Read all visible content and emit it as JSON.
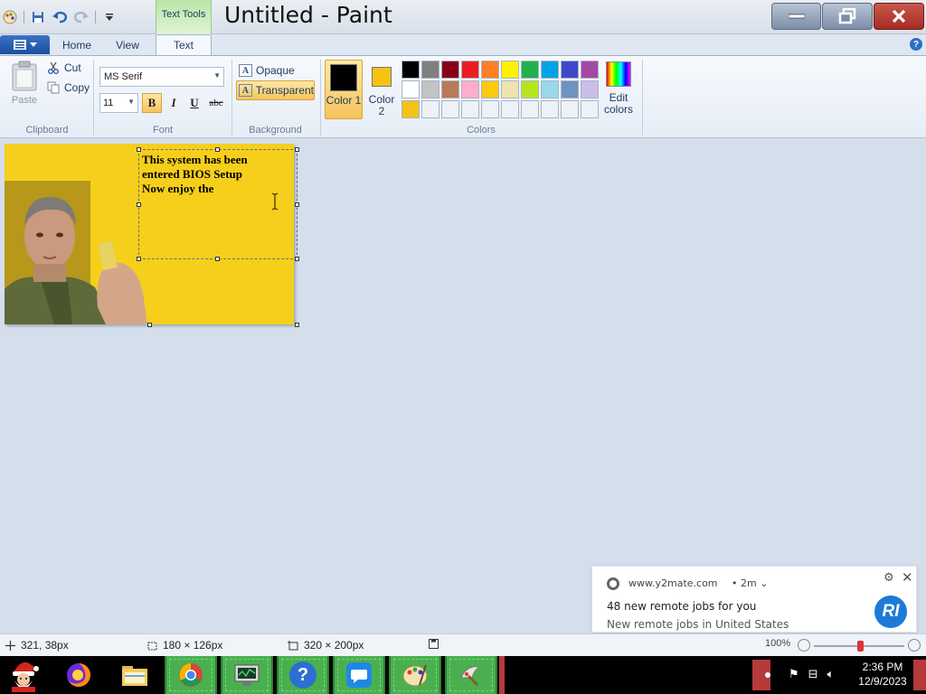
{
  "window": {
    "title": "Untitled - Paint",
    "contextual_tab_label": "Text Tools"
  },
  "tabs": [
    {
      "label": "Home"
    },
    {
      "label": "View"
    },
    {
      "label": "Text"
    }
  ],
  "ribbon": {
    "clipboard": {
      "paste_label": "Paste",
      "cut_label": "Cut",
      "copy_label": "Copy",
      "group_label": "Clipboard"
    },
    "font": {
      "family": "MS Serif",
      "size": "11",
      "bold_label": "B",
      "italic_label": "I",
      "underline_label": "U",
      "strike_label": "abc",
      "group_label": "Font",
      "bold_active": true
    },
    "background": {
      "opaque_label": "Opaque",
      "transparent_label": "Transparent",
      "group_label": "Background",
      "selected": "Transparent"
    },
    "colors": {
      "color1_label": "Color 1",
      "color2_label": "Color 2",
      "edit_label": "Edit colors",
      "group_label": "Colors",
      "color1": "#000000",
      "color2": "#f4c314",
      "palette": [
        "#000000",
        "#7f7f7f",
        "#880015",
        "#ed1c24",
        "#ff7f27",
        "#fff200",
        "#22b14c",
        "#00a2e8",
        "#3f48cc",
        "#a349a4",
        "#ffffff",
        "#c3c3c3",
        "#b97a57",
        "#ffaec9",
        "#ffc90e",
        "#efe4b0",
        "#b5e61d",
        "#99d9ea",
        "#7092be",
        "#c8bfe7",
        "#f4c314",
        "",
        "",
        "",
        "",
        "",
        "",
        "",
        "",
        ""
      ]
    }
  },
  "canvas": {
    "background_color": "#f6cf1c",
    "text_lines": [
      "This system has been",
      "entered BIOS Setup",
      "Now enjoy the"
    ]
  },
  "notification": {
    "source": "www.y2mate.com",
    "time": "• 2m ⌄",
    "title": "48 new remote jobs for you",
    "body": "New remote jobs in United States",
    "avatar_text": "RI"
  },
  "statusbar": {
    "cursor_position": "321, 38px",
    "selection_size": "180 × 126px",
    "canvas_size": "320 × 200px",
    "zoom": "100%"
  },
  "taskbar": {
    "apps": [
      "santa-start",
      "firefox",
      "file-explorer",
      "chrome",
      "system-monitor",
      "help",
      "messenger",
      "paint",
      "tool"
    ],
    "clock_time": "2:36 PM",
    "clock_date": "12/9/2023"
  }
}
